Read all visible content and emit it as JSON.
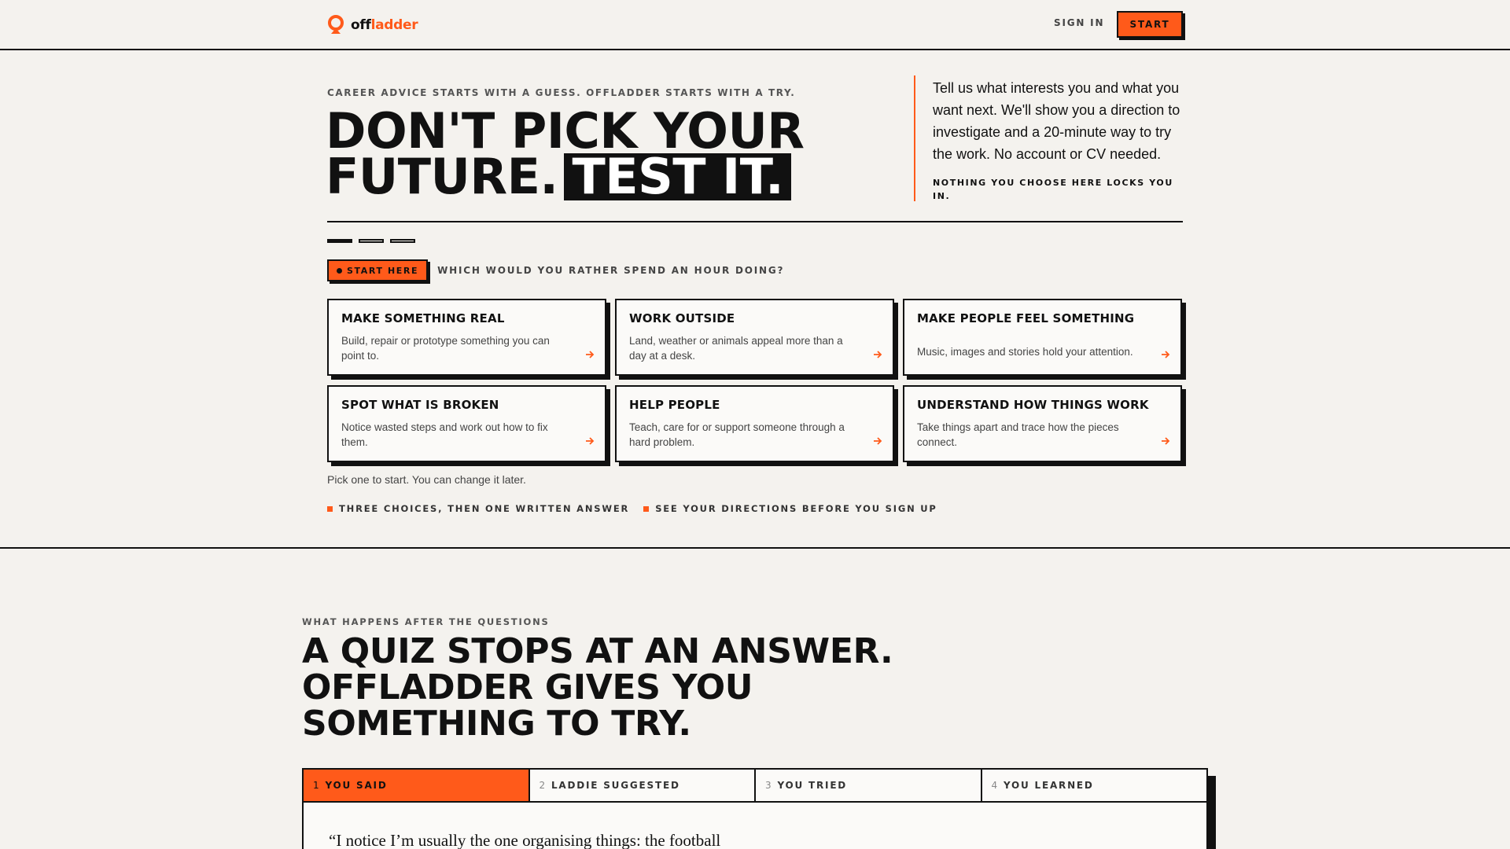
{
  "nav": {
    "brand_off": "off",
    "brand_ladder": "ladder",
    "sign_in": "SIGN IN",
    "start": "START"
  },
  "hero": {
    "eyebrow": "CAREER ADVICE STARTS WITH A GUESS. OFFLADDER STARTS WITH A TRY.",
    "headline_line1": "DON'T PICK YOUR",
    "headline_line2": "FUTURE.",
    "headline_highlight": "TEST IT.",
    "aside_text": "Tell us what interests you and what you want next. We'll show you a direction to investigate and a 20-minute way to try the work. No account or CV needed.",
    "aside_note": "NOTHING YOU CHOOSE HERE LOCKS YOU IN.",
    "progress": {
      "current_step": 1,
      "total_steps": 3
    },
    "start_here": "START HERE",
    "question": "WHICH WOULD YOU RATHER SPEND AN HOUR DOING?",
    "cards": [
      {
        "title": "MAKE SOMETHING REAL",
        "desc": "Build, repair or prototype something you can point to."
      },
      {
        "title": "WORK OUTSIDE",
        "desc": "Land, weather or animals appeal more than a day at a desk."
      },
      {
        "title": "MAKE PEOPLE FEEL SOMETHING",
        "desc": "Music, images and stories hold your attention."
      },
      {
        "title": "SPOT WHAT IS BROKEN",
        "desc": "Notice wasted steps and work out how to fix them."
      },
      {
        "title": "HELP PEOPLE",
        "desc": "Teach, care for or support someone through a hard problem."
      },
      {
        "title": "UNDERSTAND HOW THINGS WORK",
        "desc": "Take things apart and trace how the pieces connect."
      }
    ],
    "pick_note": "Pick one to start. You can change it later.",
    "bullets": [
      "THREE CHOICES, THEN ONE WRITTEN ANSWER",
      "SEE YOUR DIRECTIONS BEFORE YOU SIGN UP"
    ]
  },
  "section2": {
    "eyebrow": "WHAT HAPPENS AFTER THE QUESTIONS",
    "title": "A QUIZ STOPS AT AN ANSWER. OFFLADDER GIVES YOU SOMETHING TO TRY.",
    "tabs": [
      {
        "num": "1",
        "label": "YOU SAID"
      },
      {
        "num": "2",
        "label": "LADDIE SUGGESTED"
      },
      {
        "num": "3",
        "label": "YOU TRIED"
      },
      {
        "num": "4",
        "label": "YOU LEARNED"
      }
    ],
    "active_tab": "1",
    "quote": "“I notice I’m usually the one organising things: the football"
  },
  "colors": {
    "accent": "#ff5a1a",
    "ink": "#111111",
    "background": "#f4f2ee"
  },
  "icons": {
    "brand": "person-marker-icon",
    "card_arrow": "arrow-right-icon"
  }
}
